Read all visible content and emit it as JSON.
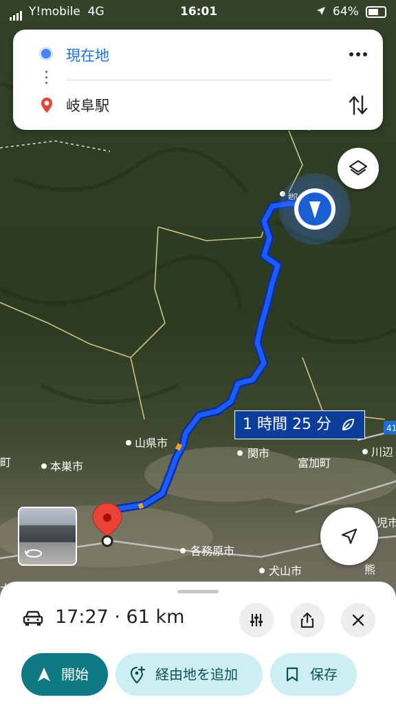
{
  "status_bar": {
    "carrier": "Y!mobile",
    "network": "4G",
    "time": "16:01",
    "battery": "64%"
  },
  "route": {
    "origin": "現在地",
    "destination": "岐阜駅"
  },
  "map": {
    "labels": {
      "gun": "郡",
      "yamagata": "山県市",
      "motosu": "本巣市",
      "seki": "関市",
      "tomika": "富加町",
      "kawabe": "川辺",
      "kakamigahara": "各務原市",
      "inuyama": "犬山市",
      "mino": "町",
      "kani": "児市",
      "ou": "大",
      "kuma": "熊"
    },
    "road_number": "41",
    "route_duration": "1 時間 25 分",
    "colors": {
      "route": "#1a5cff",
      "route_traffic": "#f4a21b",
      "dest_pin": "#ea4335"
    }
  },
  "bottom_sheet": {
    "eta": "17:27",
    "distance": "61 km",
    "summary": "17:27 · 61 km",
    "start_label": "開始",
    "add_waypoint_label": "経由地を追加",
    "save_label": "保存"
  },
  "icons": {
    "origin": "blue-dot-icon",
    "destination": "red-pin-icon",
    "more": "more-horizontal-icon",
    "swap": "swap-vertical-icon",
    "layers": "layers-icon",
    "recenter": "navigation-arrow-icon",
    "car": "car-icon",
    "options": "tune-icon",
    "share": "share-icon",
    "close": "close-icon",
    "start": "navigation-icon",
    "waypoint": "add-location-icon",
    "save": "bookmark-icon",
    "eco": "leaf-icon"
  }
}
